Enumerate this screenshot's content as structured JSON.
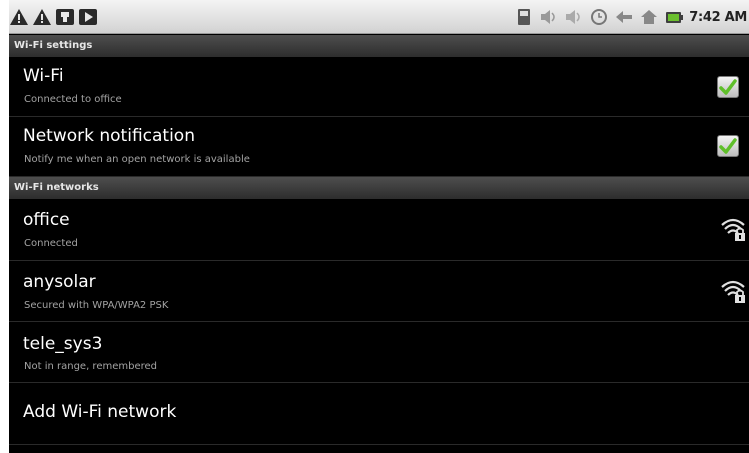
{
  "status_bar": {
    "time": "7:42 AM",
    "left_icons": [
      "warning-icon",
      "warning-icon",
      "usb-debug-icon",
      "media-play-icon"
    ],
    "right_icons": [
      "sd-card-icon",
      "volume-icon",
      "volume-muted-icon",
      "clock-icon",
      "back-icon",
      "home-icon",
      "battery-icon"
    ]
  },
  "sections": {
    "wifi_settings": "Wi-Fi settings",
    "wifi_networks": "Wi-Fi networks"
  },
  "settings": [
    {
      "title": "Wi-Fi",
      "subtitle": "Connected to office",
      "checked": true
    },
    {
      "title": "Network notification",
      "subtitle": "Notify me when an open network is available",
      "checked": true
    }
  ],
  "networks": [
    {
      "name": "office",
      "status": "Connected",
      "icon": "wifi-lock-icon"
    },
    {
      "name": "anysolar",
      "status": "Secured with WPA/WPA2 PSK",
      "icon": "wifi-lock-icon"
    },
    {
      "name": "tele_sys3",
      "status": "Not in range, remembered",
      "icon": ""
    }
  ],
  "add_network_label": "Add Wi-Fi network",
  "colors": {
    "background": "#000000",
    "section_header": "#3a3a3a",
    "checkbox_check": "#5fbf2a",
    "subtitle": "#a3a3a3"
  }
}
